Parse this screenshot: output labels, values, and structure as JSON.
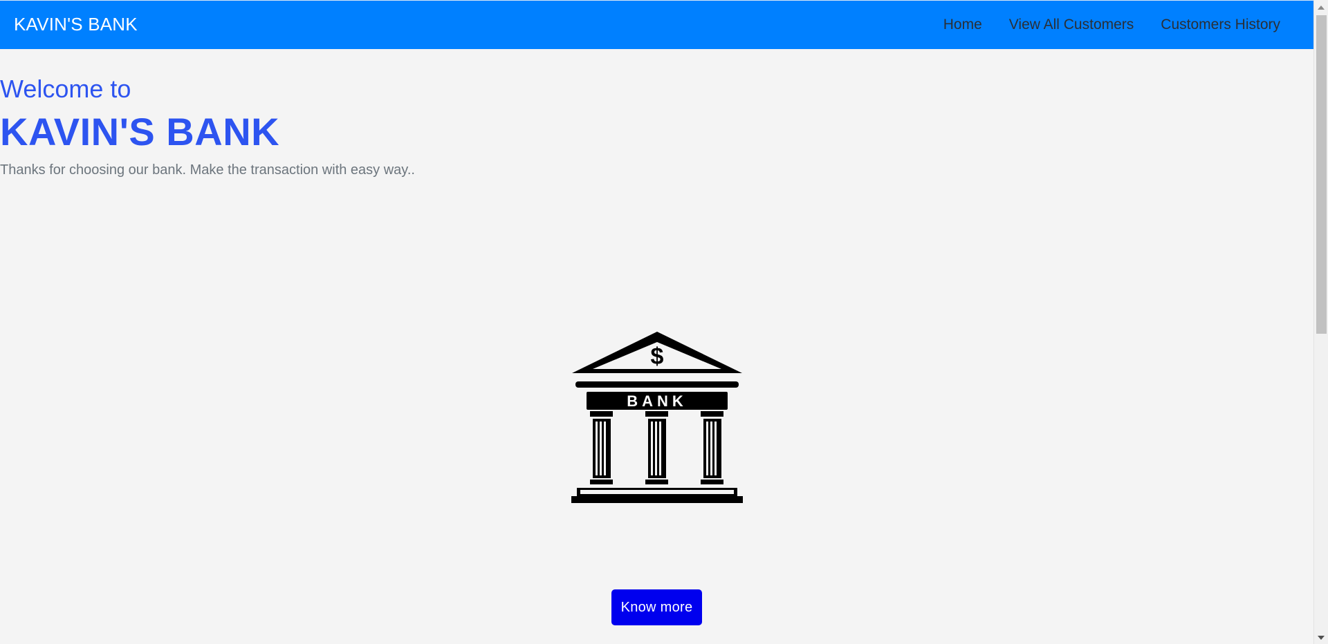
{
  "navbar": {
    "brand": "KAVIN'S BANK",
    "links": [
      "Home",
      "View All Customers",
      "Customers History"
    ],
    "background_color": "#0080ff"
  },
  "hero": {
    "welcome": "Welcome to",
    "title": "KAVIN'S BANK",
    "tagline": "Thanks for choosing our bank. Make the transaction with easy way..",
    "accent_color": "#2d54f0"
  },
  "illustration": {
    "icon": "bank-building-icon",
    "symbol": "$",
    "sign_text": "BANK"
  },
  "cta": {
    "label": "Know more",
    "color": "#0000ee"
  }
}
